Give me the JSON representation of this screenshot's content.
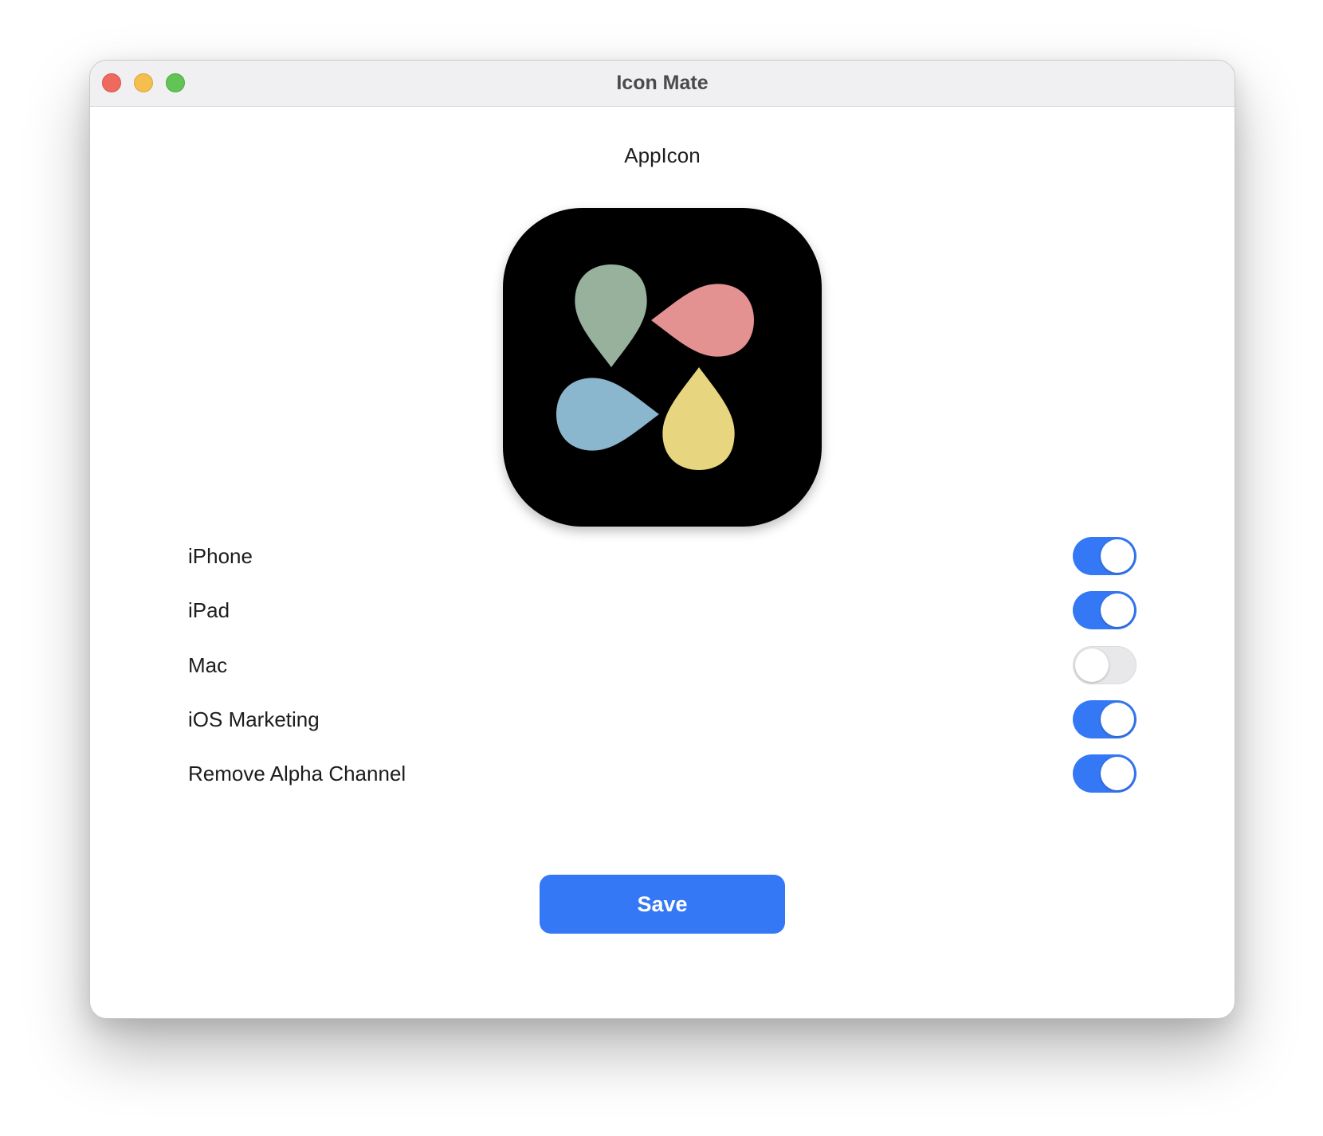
{
  "window": {
    "title": "Icon Mate"
  },
  "main": {
    "section_title": "AppIcon",
    "options": [
      {
        "label": "iPhone",
        "enabled": true
      },
      {
        "label": "iPad",
        "enabled": true
      },
      {
        "label": "Mac",
        "enabled": false
      },
      {
        "label": "iOS Marketing",
        "enabled": true
      },
      {
        "label": "Remove Alpha Channel",
        "enabled": true
      }
    ],
    "save_label": "Save"
  },
  "icon": {
    "description_colors": {
      "background": "#000000",
      "green_drop": "#97b19d",
      "pink_drop": "#e49192",
      "blue_drop": "#8ab6ce",
      "yellow_drop": "#e8d580"
    }
  },
  "colors": {
    "accent": "#3478f6",
    "toggle_off": "#e8e8ea",
    "close": "#ee6a5e",
    "minimize": "#f5bf4f",
    "maximize": "#61c454"
  }
}
